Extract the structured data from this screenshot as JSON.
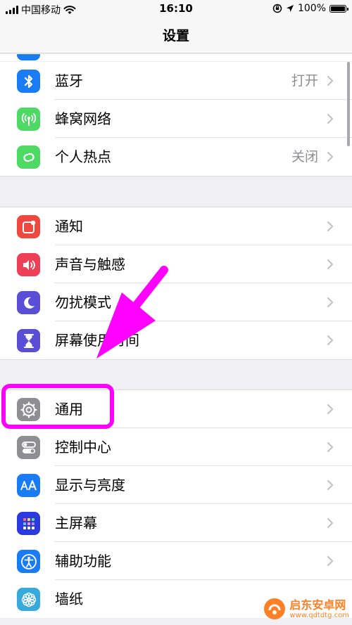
{
  "status_bar": {
    "carrier": "中国移动",
    "time": "16:10",
    "battery": "100%",
    "battery_level": 1.0
  },
  "nav": {
    "title": "设置"
  },
  "groups": [
    [
      {
        "name": "bluetooth",
        "label": "蓝牙",
        "value": "打开",
        "color": "#1a7cf5",
        "icon": "bluetooth-icon"
      },
      {
        "name": "cellular",
        "label": "蜂窝网络",
        "value": "",
        "color": "#4cd964",
        "icon": "antenna-icon"
      },
      {
        "name": "hotspot",
        "label": "个人热点",
        "value": "关闭",
        "color": "#4cd964",
        "icon": "link-icon"
      }
    ],
    [
      {
        "name": "notifications",
        "label": "通知",
        "value": "",
        "color": "#f0483e",
        "icon": "notification-icon"
      },
      {
        "name": "sounds",
        "label": "声音与触感",
        "value": "",
        "color": "#ef3f56",
        "icon": "speaker-icon"
      },
      {
        "name": "dnd",
        "label": "勿扰模式",
        "value": "",
        "color": "#5b4ed6",
        "icon": "moon-icon"
      },
      {
        "name": "screentime",
        "label": "屏幕使用时间",
        "value": "",
        "color": "#5b4ed6",
        "icon": "hourglass-icon"
      }
    ],
    [
      {
        "name": "general",
        "label": "通用",
        "value": "",
        "color": "#8e8e93",
        "icon": "gear-icon"
      },
      {
        "name": "control-center",
        "label": "控制中心",
        "value": "",
        "color": "#8e8e93",
        "icon": "toggle-icon"
      },
      {
        "name": "display",
        "label": "显示与亮度",
        "value": "",
        "color": "#1a7cf5",
        "icon": "text-size-icon"
      },
      {
        "name": "home-screen",
        "label": "主屏幕",
        "value": "",
        "color": "#2b3ae0",
        "icon": "grid-icon"
      },
      {
        "name": "accessibility",
        "label": "辅助功能",
        "value": "",
        "color": "#1a7cf5",
        "icon": "accessibility-icon"
      },
      {
        "name": "wallpaper",
        "label": "墙纸",
        "value": "",
        "color": "#36aadc",
        "icon": "flower-icon"
      }
    ]
  ],
  "annotation": {
    "color": "#ff00ff"
  },
  "watermark": {
    "text": "启东安卓网",
    "url": "www.qdtdtg.com"
  }
}
